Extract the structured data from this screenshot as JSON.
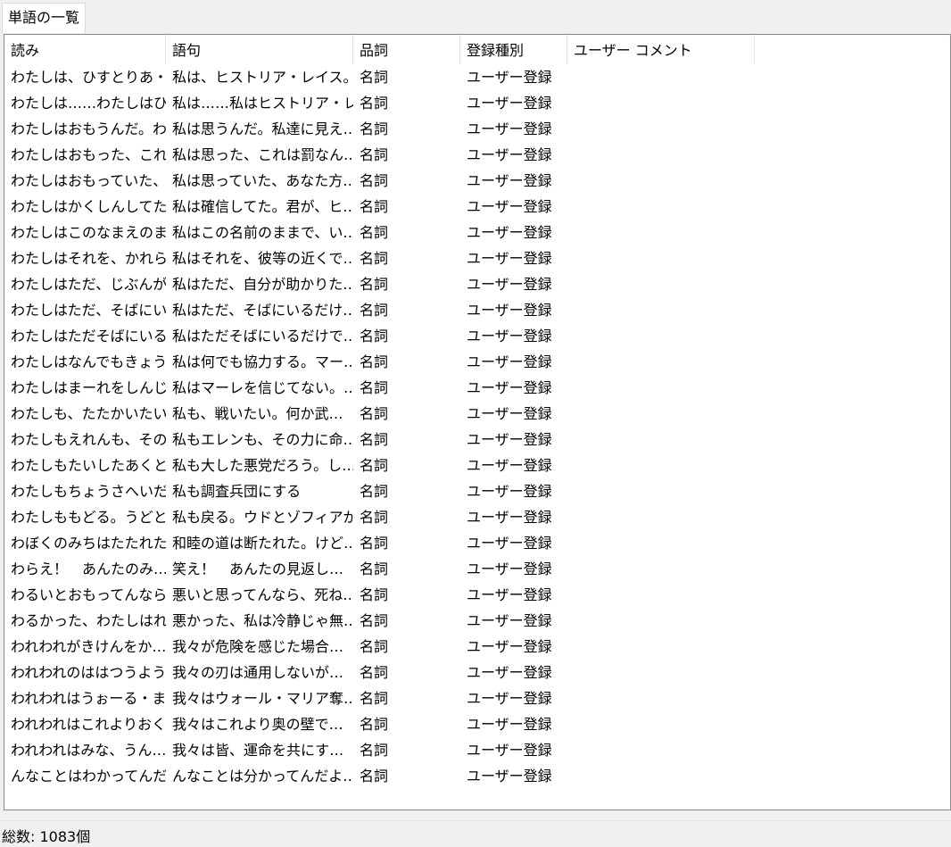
{
  "tab": {
    "label": "単語の一覧"
  },
  "columns": [
    "読み",
    "語句",
    "品詞",
    "登録種別",
    "ユーザー コメント"
  ],
  "rows": [
    [
      "わたしは、ひすとりあ・…",
      "私は、ヒストリア・レイス。こ…",
      "名詞",
      "ユーザー登録",
      ""
    ],
    [
      "わたしは……わたしはひ…",
      "私は……私はヒストリア・レ…",
      "名詞",
      "ユーザー登録",
      ""
    ],
    [
      "わたしはおもうんだ。わ…",
      "私は思うんだ。私達に見え…",
      "名詞",
      "ユーザー登録",
      ""
    ],
    [
      "わたしはおもった、これ…",
      "私は思った、これは罰なん…",
      "名詞",
      "ユーザー登録",
      ""
    ],
    [
      "わたしはおもっていた、…",
      "私は思っていた、あなた方…",
      "名詞",
      "ユーザー登録",
      ""
    ],
    [
      "わたしはかくしんしてた…",
      "私は確信してた。君が、ヒ…",
      "名詞",
      "ユーザー登録",
      ""
    ],
    [
      "わたしはこのなまえのま…",
      "私はこの名前のままで、い…",
      "名詞",
      "ユーザー登録",
      ""
    ],
    [
      "わたしはそれを、かれら…",
      "私はそれを、彼等の近くで…",
      "名詞",
      "ユーザー登録",
      ""
    ],
    [
      "わたしはただ、じぶんが…",
      "私はただ、自分が助かりた…",
      "名詞",
      "ユーザー登録",
      ""
    ],
    [
      "わたしはただ、そばにい…",
      "私はただ、そばにいるだけ…",
      "名詞",
      "ユーザー登録",
      ""
    ],
    [
      "わたしはただそばにいる…",
      "私はただそばにいるだけで…",
      "名詞",
      "ユーザー登録",
      ""
    ],
    [
      "わたしはなんでもきょう…",
      "私は何でも協力する。マー…",
      "名詞",
      "ユーザー登録",
      ""
    ],
    [
      "わたしはまーれをしんじ…",
      "私はマーレを信じてない。…",
      "名詞",
      "ユーザー登録",
      ""
    ],
    [
      "わたしも、たたかいたい…",
      "私も、戦いたい。何か武…",
      "名詞",
      "ユーザー登録",
      ""
    ],
    [
      "わたしもえれんも、その…",
      "私もエレンも、その力に命…",
      "名詞",
      "ユーザー登録",
      ""
    ],
    [
      "わたしもたいしたあくと…",
      "私も大した悪党だろう。し…",
      "名詞",
      "ユーザー登録",
      ""
    ],
    [
      "わたしもちょうさへいだ…",
      "私も調査兵団にする",
      "名詞",
      "ユーザー登録",
      ""
    ],
    [
      "わたしももどる。うどと…",
      "私も戻る。ウドとゾフィアが…",
      "名詞",
      "ユーザー登録",
      ""
    ],
    [
      "わぼくのみちはたたれた…",
      "和睦の道は断たれた。けど…",
      "名詞",
      "ユーザー登録",
      ""
    ],
    [
      "わらえ！　あんたのみ…",
      "笑え！　あんたの見返し…",
      "名詞",
      "ユーザー登録",
      ""
    ],
    [
      "わるいとおもってんなら…",
      "悪いと思ってんなら、死ね…",
      "名詞",
      "ユーザー登録",
      ""
    ],
    [
      "わるかった、わたしはれ…",
      "悪かった、私は冷静じゃ無…",
      "名詞",
      "ユーザー登録",
      ""
    ],
    [
      "われわれがきけんをか…",
      "我々が危険を感じた場合…",
      "名詞",
      "ユーザー登録",
      ""
    ],
    [
      "われわれのははつうよう…",
      "我々の刃は通用しないが…",
      "名詞",
      "ユーザー登録",
      ""
    ],
    [
      "われわれはうぉーる・ま…",
      "我々はウォール・マリア奪…",
      "名詞",
      "ユーザー登録",
      ""
    ],
    [
      "われわれはこれよりおく…",
      "我々はこれより奥の壁で…",
      "名詞",
      "ユーザー登録",
      ""
    ],
    [
      "われわれはみな、うん…",
      "我々は皆、運命を共にす…",
      "名詞",
      "ユーザー登録",
      ""
    ],
    [
      "んなことはわかってんだ…",
      "んなことは分かってんだよ…",
      "名詞",
      "ユーザー登録",
      ""
    ]
  ],
  "status": {
    "text": "総数: 1083個"
  }
}
